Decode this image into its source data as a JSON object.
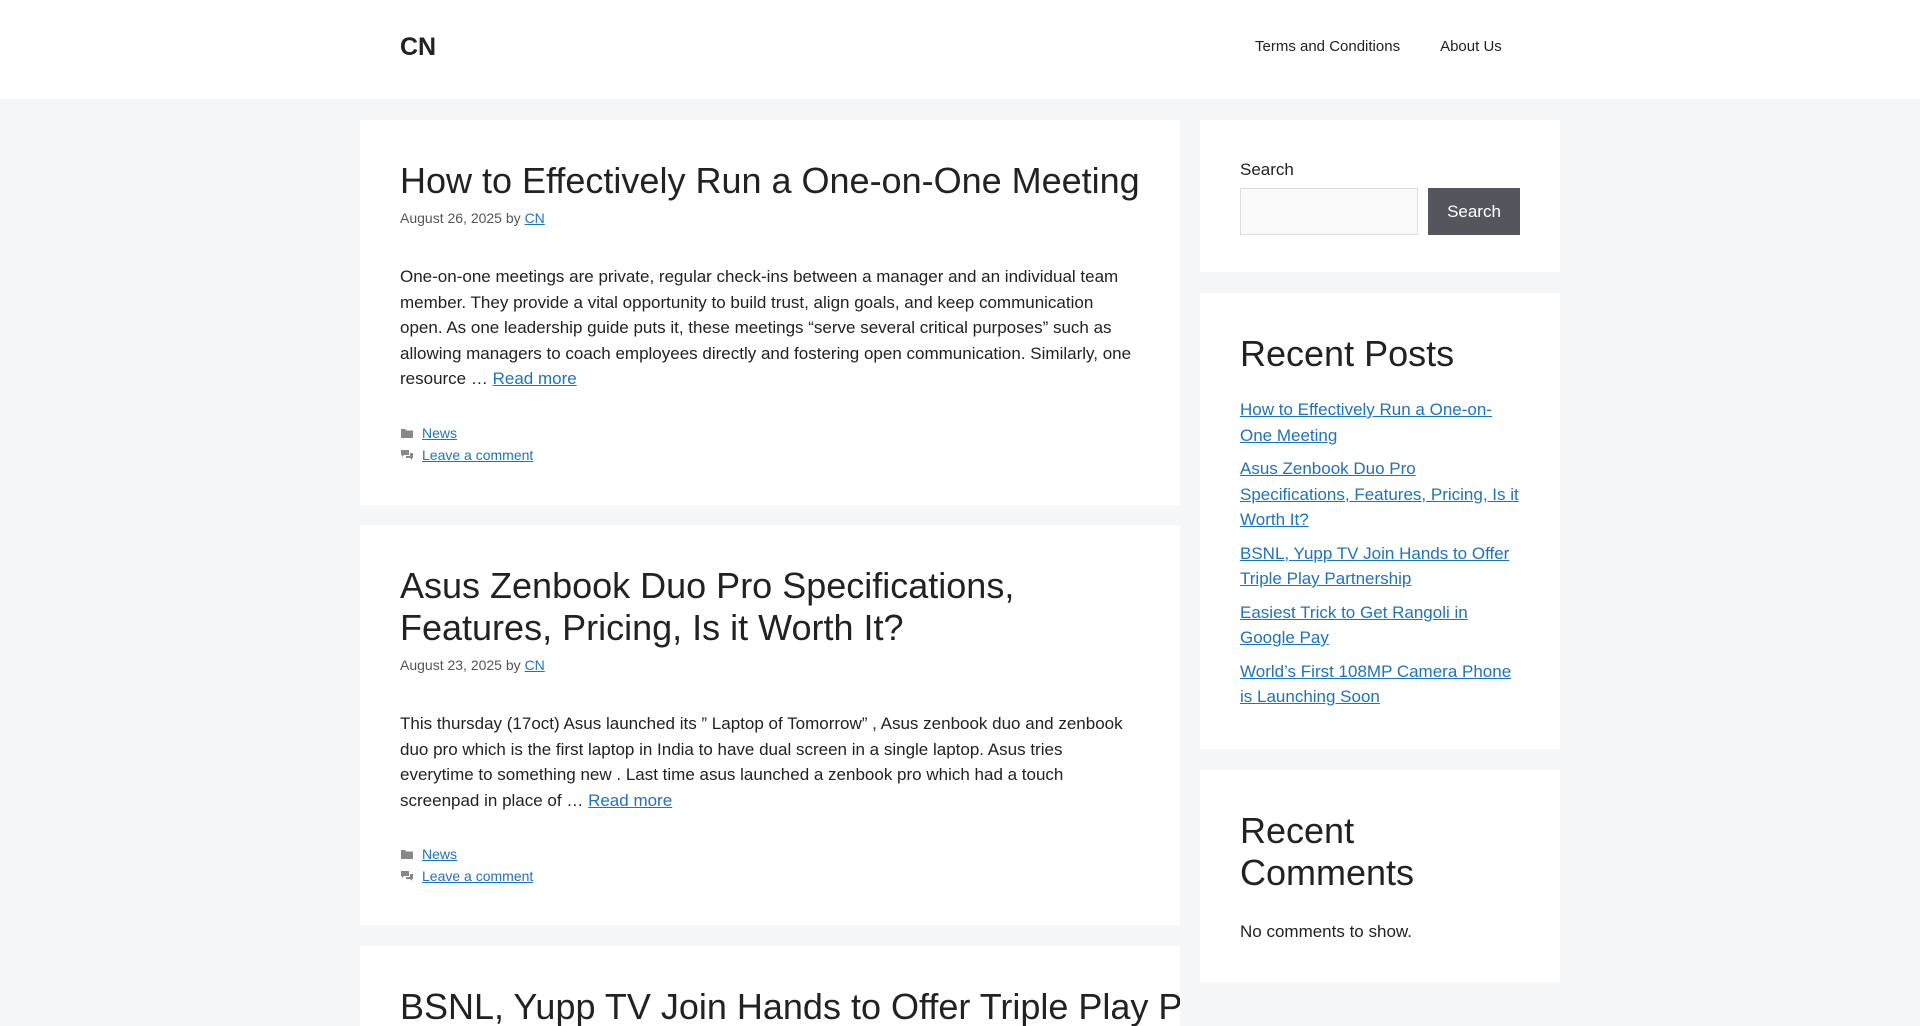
{
  "site": {
    "title": "CN"
  },
  "nav": [
    {
      "label": "Terms and Conditions"
    },
    {
      "label": "About Us"
    }
  ],
  "posts": [
    {
      "title": "How to Effectively Run a One-on-One Meeting",
      "date": "August 26, 2025",
      "by": "by",
      "author": "CN",
      "excerpt": "One-on-one meetings are private, regular check-ins between a manager and an individual team member. They provide a vital opportunity to build trust, align goals, and keep communication open. As one leadership guide puts it, these meetings “serve several critical purposes” such as allowing managers to coach employees directly and fostering open communication. Similarly, one resource …",
      "read_more": "Read more",
      "category": "News",
      "comment_link": "Leave a comment"
    },
    {
      "title": "Asus Zenbook Duo Pro Specifications, Features, Pricing, Is it Worth It?",
      "date": "August 23, 2025",
      "by": "by",
      "author": "CN",
      "excerpt": "This thursday (17oct) Asus launched its ” Laptop of Tomorrow” , Asus zenbook duo and zenbook duo pro which is the first laptop in India to have dual screen in a single laptop. Asus tries everytime to something new . Last time asus launched a zenbook pro which had a touch screenpad in place of …",
      "read_more": "Read more",
      "category": "News",
      "comment_link": "Leave a comment"
    },
    {
      "title": "BSNL, Yupp TV Join Hands to Offer Triple Play Partnership"
    }
  ],
  "sidebar": {
    "search_label": "Search",
    "search_button": "Search",
    "search_placeholder": "",
    "recent_posts_title": "Recent Posts",
    "recent_posts": [
      "How to Effectively Run a One-on-One Meeting",
      "Asus Zenbook Duo Pro Specifications, Features, Pricing, Is it Worth It?",
      "BSNL, Yupp TV Join Hands to Offer Triple Play Partnership",
      "Easiest Trick to Get Rangoli in Google Pay",
      "World’s First 108MP Camera Phone is Launching Soon"
    ],
    "recent_comments_title": "Recent Comments",
    "no_comments": "No comments to show."
  },
  "colors": {
    "link": "#1e73be",
    "background": "#f6f7f8",
    "button": "#55555e"
  }
}
